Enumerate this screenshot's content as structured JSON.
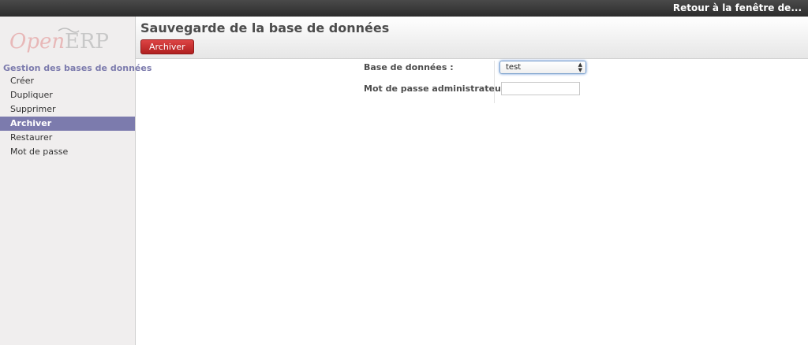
{
  "topbar": {
    "back_link": "Retour à la fenêtre de..."
  },
  "sidebar": {
    "logo": {
      "part1": "Open",
      "part2": "ERP"
    },
    "heading": "Gestion des bases de données",
    "items": [
      {
        "label": "Créer",
        "active": false
      },
      {
        "label": "Dupliquer",
        "active": false
      },
      {
        "label": "Supprimer",
        "active": false
      },
      {
        "label": "Archiver",
        "active": true
      },
      {
        "label": "Restaurer",
        "active": false
      },
      {
        "label": "Mot de passe",
        "active": false
      }
    ]
  },
  "header": {
    "title": "Sauvegarde de la base de données",
    "archive_button": "Archiver"
  },
  "form": {
    "database_label": "Base de données :",
    "database_value": "test",
    "password_label": "Mot de passe administrateur :",
    "password_value": ""
  },
  "colors": {
    "accent": "#7c7bad",
    "button": "#c62828",
    "topbar": "#333333"
  }
}
